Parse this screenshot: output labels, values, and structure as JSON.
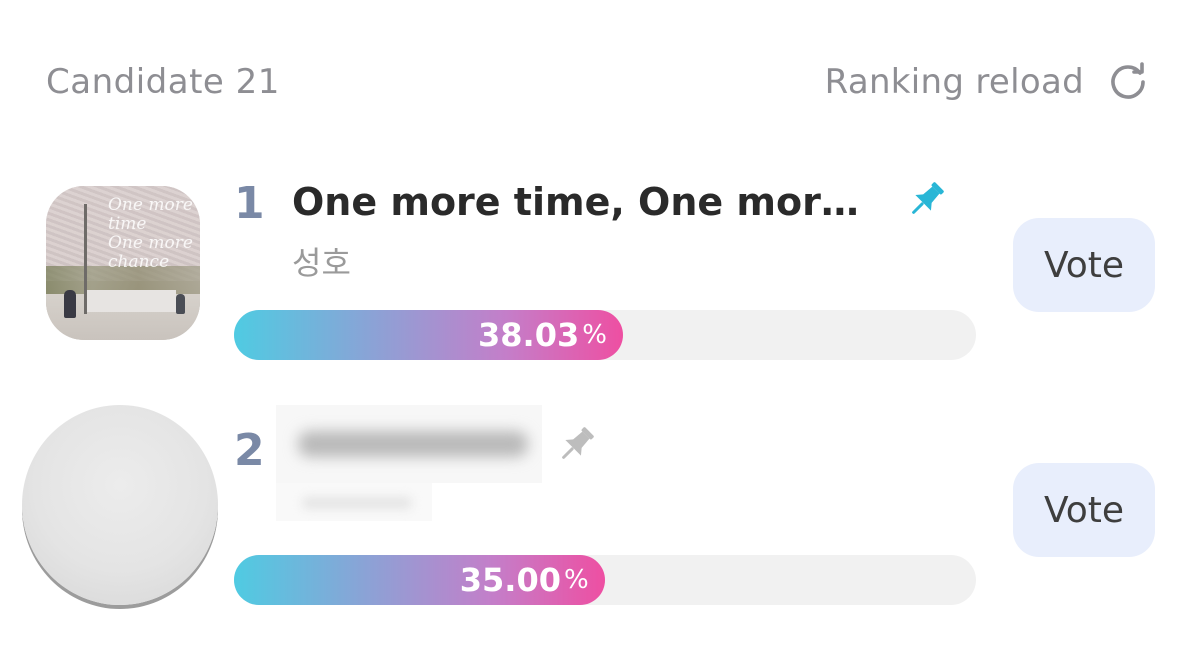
{
  "header": {
    "candidate_label": "Candidate 21",
    "reload_label": "Ranking reload",
    "reload_icon": "refresh-icon"
  },
  "colors": {
    "rank": "#7a89a6",
    "pin_active": "#29b6d6",
    "pin_inactive": "#bdbdbd",
    "vote_bg": "#e8eefc",
    "bar_start": "#4fcbe2",
    "bar_end": "#ee4fa2"
  },
  "candidates": [
    {
      "rank": "1",
      "title": "One more time, One more...",
      "artist": "성호",
      "percent_text": "38.03",
      "percent_symbol": "%",
      "share": 0.5242,
      "pinned": true,
      "vote_label": "Vote"
    },
    {
      "rank": "2",
      "title": "",
      "artist": "",
      "percent_text": "35.00",
      "percent_symbol": "%",
      "share": 0.4996,
      "pinned": false,
      "vote_label": "Vote"
    }
  ]
}
